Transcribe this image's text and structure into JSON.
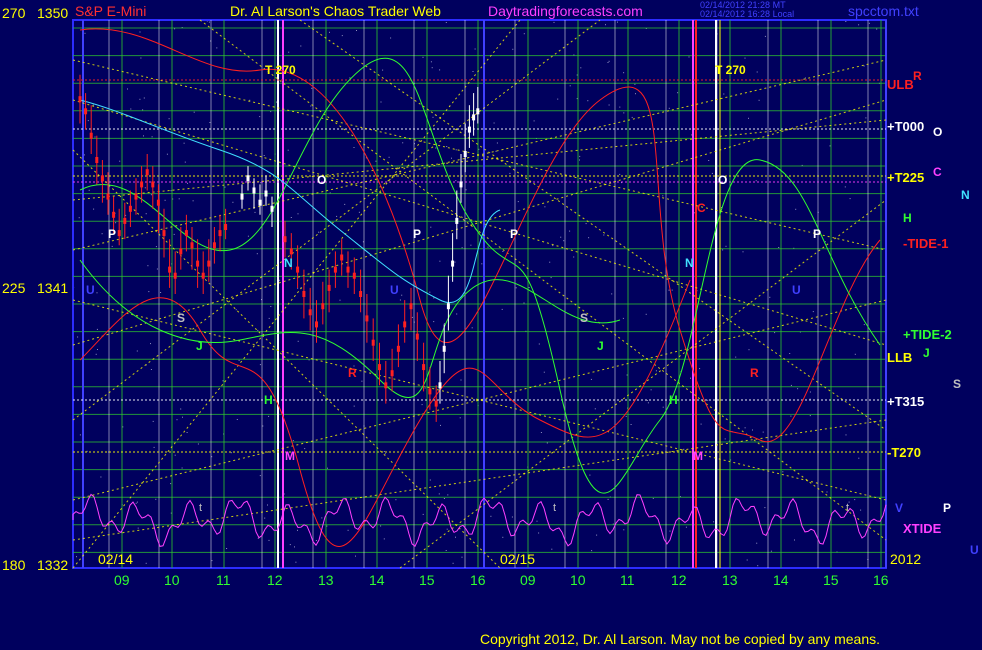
{
  "header": {
    "instrument": "S&P E-Mini",
    "site_title": "Dr. Al Larson's Chaos Trader Web",
    "site_url": "Daytradingforecasts.com",
    "timestamp_line1": "02/14/2012 21:28 MT",
    "timestamp_line2": "02/14/2012 16:28 Local",
    "filename": "spcctom.txt"
  },
  "footer": {
    "copyright": "Copyright 2012, Dr. Al Larson. May not be copied by any means."
  },
  "colors": {
    "background": "#00005e",
    "plot_frame": "#2c2cff",
    "grid_green": "#2ec82e",
    "yellow": "#ffff00",
    "red": "#ff2020",
    "white": "#ffffff",
    "magenta": "#ff40ff",
    "cyan": "#40e0ff",
    "green": "#30ff30",
    "blue": "#4040ff",
    "pink": "#ff40ff",
    "gray": "#c0c0c0"
  },
  "chart_data": {
    "type": "line",
    "y_axis_left_labels": [
      {
        "text": "270",
        "value": 1350
      },
      {
        "text": "1350",
        "value": 1350
      },
      {
        "text": "225",
        "value": 1341
      },
      {
        "text": "1341",
        "value": 1341
      },
      {
        "text": "180",
        "value": 1332
      },
      {
        "text": "1332",
        "value": 1332
      }
    ],
    "ylim": [
      1332,
      1350
    ],
    "date_labels": [
      "02/14",
      "02/15",
      "2012"
    ],
    "hour_ticks": [
      "09",
      "10",
      "11",
      "12",
      "13",
      "14",
      "15",
      "16",
      "09",
      "10",
      "11",
      "12",
      "13",
      "14",
      "15",
      "16"
    ],
    "level_labels": [
      {
        "text": "ULB",
        "color": "#ff2020"
      },
      {
        "text": "+T000",
        "color": "#ffffff"
      },
      {
        "text": "+T225",
        "color": "#ffff00"
      },
      {
        "text": "-TIDE-1",
        "color": "#ff2020"
      },
      {
        "text": "+TIDE-2",
        "color": "#30ff30"
      },
      {
        "text": "LLB",
        "color": "#ffff00"
      },
      {
        "text": "+T315",
        "color": "#ffffff"
      },
      {
        "text": "-T270",
        "color": "#ffff00"
      },
      {
        "text": "XTIDE",
        "color": "#ff40ff"
      }
    ],
    "legend_letters": [
      {
        "text": "R",
        "color": "#ff2020"
      },
      {
        "text": "O",
        "color": "#ffffff"
      },
      {
        "text": "C",
        "color": "#ff40ff"
      },
      {
        "text": "N",
        "color": "#40e0ff"
      },
      {
        "text": "H",
        "color": "#30ff30"
      },
      {
        "text": "J",
        "color": "#30ff30"
      },
      {
        "text": "S",
        "color": "#c0c0c0"
      },
      {
        "text": "V",
        "color": "#4040ff"
      },
      {
        "text": "P",
        "color": "#ffffff"
      },
      {
        "text": "U",
        "color": "#4040ff"
      }
    ],
    "in_plot_labels": [
      {
        "text": "T 270",
        "color": "#ffff00"
      },
      {
        "text": "T 270",
        "color": "#ffff00"
      },
      {
        "text": "O",
        "color": "#ffffff"
      },
      {
        "text": "O",
        "color": "#ffffff"
      },
      {
        "text": "M",
        "color": "#ff40ff"
      },
      {
        "text": "M",
        "color": "#ff40ff"
      },
      {
        "text": "H",
        "color": "#30ff30"
      },
      {
        "text": "H",
        "color": "#30ff30"
      },
      {
        "text": "N",
        "color": "#40e0ff"
      },
      {
        "text": "N",
        "color": "#40e0ff"
      },
      {
        "text": "P",
        "color": "#ffffff"
      },
      {
        "text": "P",
        "color": "#ffffff"
      },
      {
        "text": "P",
        "color": "#ffffff"
      },
      {
        "text": "P",
        "color": "#ffffff"
      },
      {
        "text": "S",
        "color": "#c0c0c0"
      },
      {
        "text": "S",
        "color": "#c0c0c0"
      },
      {
        "text": "U",
        "color": "#4040ff"
      },
      {
        "text": "U",
        "color": "#4040ff"
      },
      {
        "text": "U",
        "color": "#4040ff"
      },
      {
        "text": "R",
        "color": "#ff2020"
      },
      {
        "text": "R",
        "color": "#ff2020"
      },
      {
        "text": "J",
        "color": "#30ff30"
      },
      {
        "text": "J",
        "color": "#30ff30"
      },
      {
        "text": "C",
        "color": "#ff2020"
      },
      {
        "text": "t",
        "color": "#c0c0c0"
      },
      {
        "text": "t",
        "color": "#c0c0c0"
      },
      {
        "text": "t",
        "color": "#c0c0c0"
      }
    ],
    "price_bars_session1": [
      [
        1347.4,
        1348.2,
        1346.6
      ],
      [
        1347.0,
        1347.6,
        1346.4
      ],
      [
        1346.2,
        1347.2,
        1345.6
      ],
      [
        1345.4,
        1346.2,
        1344.6
      ],
      [
        1344.8,
        1345.4,
        1344.0
      ],
      [
        1344.2,
        1345.0,
        1343.6
      ],
      [
        1343.6,
        1344.2,
        1343.0
      ],
      [
        1343.0,
        1343.8,
        1342.6
      ],
      [
        1343.4,
        1344.0,
        1342.8
      ],
      [
        1343.8,
        1344.4,
        1343.2
      ],
      [
        1344.2,
        1344.8,
        1343.6
      ],
      [
        1344.6,
        1345.2,
        1344.0
      ],
      [
        1345.0,
        1345.6,
        1344.4
      ],
      [
        1344.6,
        1345.2,
        1343.8
      ],
      [
        1344.0,
        1344.6,
        1343.0
      ],
      [
        1343.0,
        1343.8,
        1342.2
      ],
      [
        1341.8,
        1342.8,
        1341.2
      ],
      [
        1341.6,
        1342.4,
        1341.0
      ],
      [
        1342.4,
        1343.2,
        1341.8
      ],
      [
        1343.0,
        1343.6,
        1342.4
      ],
      [
        1342.6,
        1343.2,
        1341.8
      ],
      [
        1342.0,
        1342.8,
        1341.2
      ],
      [
        1341.6,
        1342.4,
        1341.0
      ],
      [
        1342.0,
        1342.8,
        1341.4
      ],
      [
        1342.6,
        1343.2,
        1342.0
      ],
      [
        1343.0,
        1343.6,
        1342.4
      ],
      [
        1343.2,
        1343.8,
        1342.8
      ]
    ],
    "price_bars_session1_late": [
      [
        1344.2,
        1344.6,
        1343.8
      ],
      [
        1344.8,
        1345.2,
        1344.4
      ],
      [
        1344.4,
        1344.8,
        1343.8
      ],
      [
        1344.0,
        1344.6,
        1343.6
      ],
      [
        1344.3,
        1344.9,
        1343.9
      ],
      [
        1343.8,
        1344.2,
        1343.2
      ]
    ],
    "price_bars_session2": [
      [
        1342.8,
        1343.4,
        1342.2
      ],
      [
        1342.4,
        1343.0,
        1341.8
      ],
      [
        1341.8,
        1342.6,
        1341.2
      ],
      [
        1341.0,
        1341.8,
        1340.2
      ],
      [
        1340.4,
        1341.2,
        1339.8
      ],
      [
        1340.0,
        1340.8,
        1339.4
      ],
      [
        1340.6,
        1341.4,
        1340.0
      ],
      [
        1341.2,
        1341.8,
        1340.4
      ],
      [
        1341.8,
        1342.4,
        1341.2
      ],
      [
        1342.2,
        1342.8,
        1341.6
      ],
      [
        1341.8,
        1342.4,
        1341.2
      ],
      [
        1341.6,
        1342.2,
        1341.0
      ],
      [
        1341.0,
        1341.8,
        1340.4
      ],
      [
        1340.2,
        1341.0,
        1339.4
      ],
      [
        1339.4,
        1340.2,
        1338.8
      ],
      [
        1338.6,
        1339.4,
        1338.0
      ],
      [
        1338.0,
        1338.8,
        1337.4
      ],
      [
        1338.4,
        1339.2,
        1337.8
      ],
      [
        1339.2,
        1340.0,
        1338.6
      ],
      [
        1340.0,
        1340.8,
        1339.4
      ],
      [
        1340.6,
        1341.2,
        1339.8
      ],
      [
        1339.6,
        1340.4,
        1338.8
      ],
      [
        1338.6,
        1339.4,
        1337.8
      ],
      [
        1337.8,
        1338.6,
        1337.2
      ],
      [
        1337.4,
        1338.0,
        1336.8
      ]
    ],
    "price_bars_rally": [
      [
        1338.0,
        1338.8,
        1337.4
      ],
      [
        1339.2,
        1340.0,
        1338.4
      ],
      [
        1340.6,
        1341.6,
        1339.8
      ],
      [
        1342.0,
        1343.0,
        1341.4
      ],
      [
        1343.4,
        1344.4,
        1342.8
      ],
      [
        1344.6,
        1345.6,
        1344.0
      ],
      [
        1345.6,
        1346.6,
        1345.0
      ],
      [
        1346.4,
        1347.2,
        1345.8
      ],
      [
        1346.8,
        1347.6,
        1346.2
      ],
      [
        1347.0,
        1347.8,
        1346.6
      ]
    ]
  }
}
